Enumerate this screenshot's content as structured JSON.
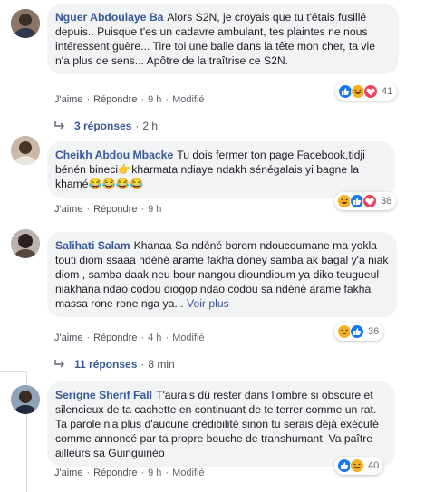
{
  "comments": [
    {
      "author": "Nguer Abdoulaye Ba",
      "text": "Alors S2N, je croyais que tu t'étais fusillé depuis.. Puisque t'es un cadavre ambulant, tes plaintes ne nous intéressent guère... Tire toi une balle dans la tête mon cher, ta vie n'a plus de sens... Apôtre de la traîtrise ce S2N.",
      "like": "J'aime",
      "reply": "Répondre",
      "time": "9 h",
      "edited": "Modifié",
      "reaction_count": "41",
      "reactions": [
        "like-icon",
        "haha-icon",
        "love-icon"
      ]
    },
    {
      "author": "Cheikh Abdou Mbacke",
      "text": "Tu dois fermer ton page Facebook,tidji bénén bineci👉kharmata ndiaye ndakh sénégalais yi bagne la khamé😂😂😂😂",
      "like": "J'aime",
      "reply": "Répondre",
      "time": "9 h",
      "reaction_count": "38",
      "reactions": [
        "haha-icon",
        "like-icon",
        "love-icon"
      ]
    },
    {
      "author": "Salihati Salam",
      "text": "Khanaa Sa ndéné borom ndoucoumane ma yokla touti diom ssaaa ndéné arame fakha doney samba ak bagal y'a niak diom , samba daak neu bour nangou dioundioum ya diko teugueul niakhana ndao codou diogop ndao codou sa ndéné arame fakha massa rone rone nga ya...",
      "see_more": "Voir plus",
      "like": "J'aime",
      "reply": "Répondre",
      "time": "4 h",
      "edited": "Modifié",
      "reaction_count": "36",
      "reactions": [
        "haha-icon",
        "like-icon"
      ]
    },
    {
      "author": "Serigne Sherif Fall",
      "text": "T'aurais dû rester dans l'ombre si obscure et silencieux de ta cachette en continuant de te terrer comme un rat. Ta parole n'a plus d'aucune crédibilité sinon tu serais déjà exécuté comme annoncé par ta propre bouche de transhumant. Va paître ailleurs sa Guinguinéo",
      "like": "J'aime",
      "reply": "Répondre",
      "time": "9 h",
      "edited": "Modifié",
      "reaction_count": "40",
      "reactions": [
        "like-icon",
        "haha-icon"
      ]
    }
  ],
  "reply_threads": [
    {
      "count": "3 réponses",
      "time": "2 h"
    },
    {
      "count": "11 réponses",
      "time": "8 min"
    }
  ],
  "colors": {
    "author": "#385898",
    "bubble": "#f2f3f5",
    "like_blue": "#1877f2",
    "haha_yellow": "#f7b125",
    "love_red": "#f33e58"
  }
}
